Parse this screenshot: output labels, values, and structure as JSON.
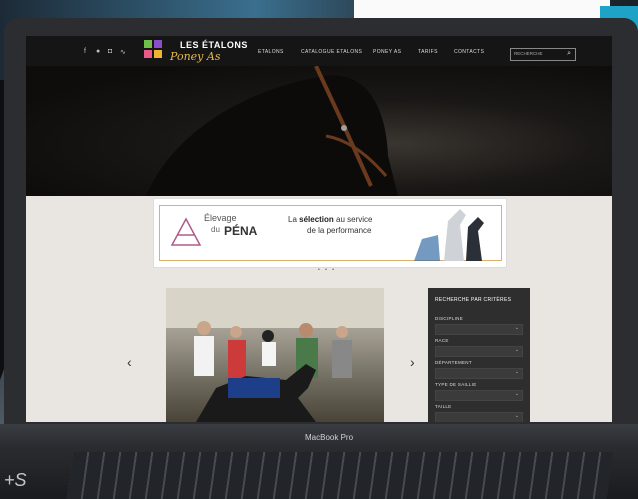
{
  "header": {
    "brand_line1": "LES ÉTALONS",
    "brand_line2": "Poney As",
    "social_icons": [
      "facebook-icon",
      "circle-icon",
      "instagram-icon",
      "rss-icon"
    ],
    "nav": [
      "ETALONS",
      "CATALOGUE ETALONS",
      "PONEY AS",
      "TARIFS",
      "CONTACTS"
    ],
    "search_placeholder": "RECHERCHE"
  },
  "banner": {
    "elevage": "Élevage",
    "du": "du",
    "pena": "PÉNA",
    "tagline_bold": "sélection",
    "tagline_line1_pre": "La ",
    "tagline_line1_post": " au service",
    "tagline_line2": "de la performance"
  },
  "carousel": {
    "dots": "• • •",
    "prev": "‹",
    "next": "›"
  },
  "filter_panel": {
    "title": "RECHERCHE PAR CRITÈRES",
    "fields": [
      "DISCIPLINE",
      "RACE",
      "DÉPARTEMENT",
      "TYPE DE SAILLIE",
      "TAILLE"
    ]
  },
  "laptop": {
    "model": "MacBook Pro"
  },
  "corner_text": "+S",
  "colors": {
    "accent": "#e8b84a",
    "header_bg": "#151515",
    "panel_bg": "#2e2e2e"
  }
}
